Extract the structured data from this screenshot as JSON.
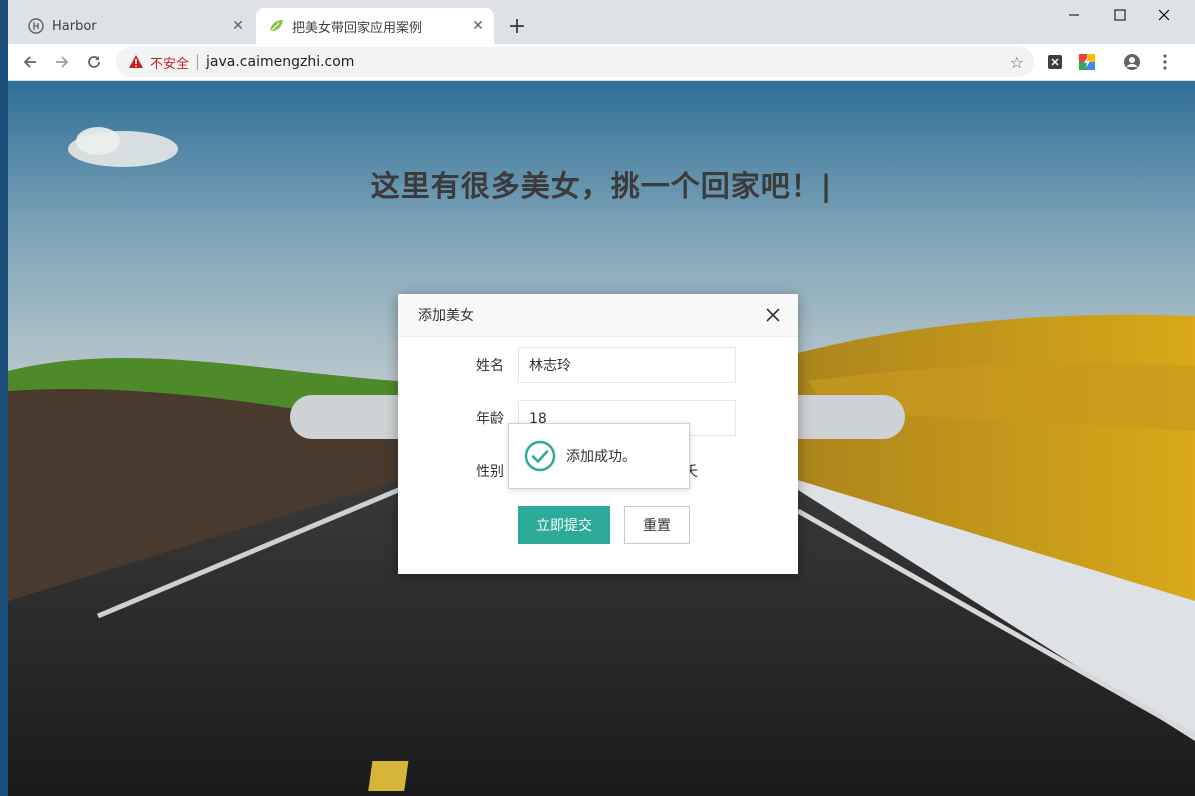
{
  "browser": {
    "tabs": [
      {
        "title": "Harbor",
        "icon": "harbor-logo-icon",
        "active": false
      },
      {
        "title": "把美女带回家应用案例",
        "icon": "leaf-icon",
        "active": true
      }
    ],
    "new_tab_label": "+",
    "insecure_label": "不安全",
    "url": "java.caimengzhi.com"
  },
  "page": {
    "headline": "这里有很多美女，挑一个回家吧！|"
  },
  "dialog": {
    "title": "添加美女",
    "fields": {
      "name_label": "姓名",
      "name_value": "林志玲",
      "age_label": "年龄",
      "age_value": "18",
      "gender_label": "性别",
      "gender_partial_text": "夭"
    },
    "submit_label": "立即提交",
    "reset_label": "重置"
  },
  "toast": {
    "message": "添加成功。",
    "icon": "check-circle-icon",
    "color": "#2eaa98"
  },
  "colors": {
    "accent": "#2eaa98",
    "insecure": "#c5221f"
  }
}
